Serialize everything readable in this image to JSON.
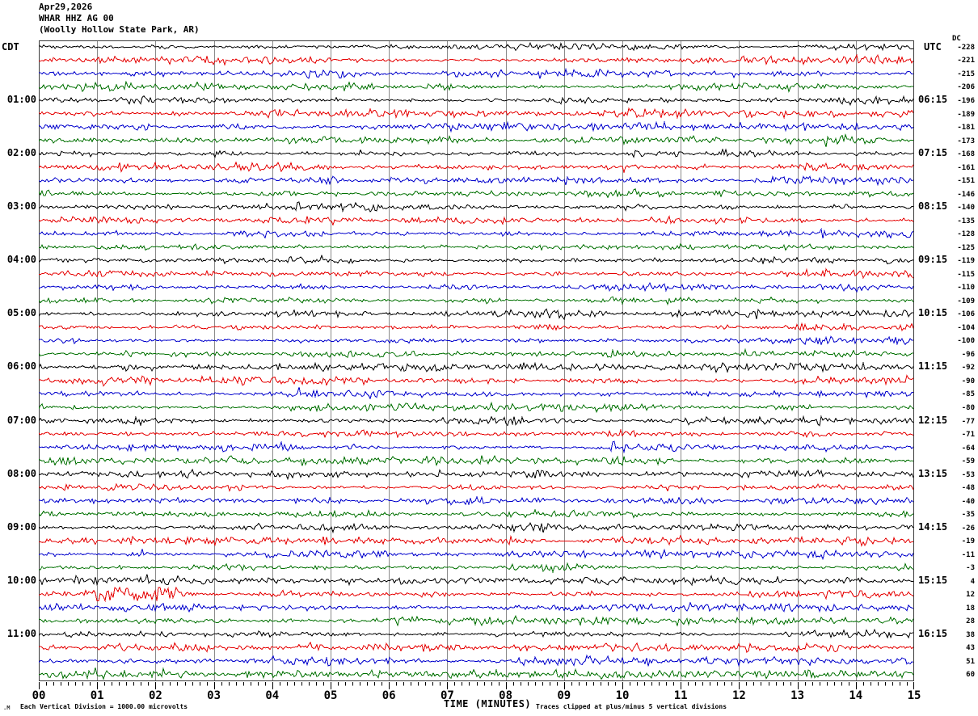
{
  "title": {
    "date": "Apr29,2026",
    "station": "WHAR HHZ AG 00",
    "location": "(Woolly Hollow State Park, AR)"
  },
  "axes": {
    "left_header": "CDT",
    "right_header": "UTC",
    "dc_header": "DC",
    "x_label": "TIME (MINUTES)",
    "x_ticks": [
      "00",
      "01",
      "02",
      "03",
      "04",
      "05",
      "06",
      "07",
      "08",
      "09",
      "10",
      "11",
      "12",
      "13",
      "14",
      "15"
    ]
  },
  "footer": {
    "scale_note": "Each Vertical Division = 1000.00 microvolts",
    "clip_note": "Traces clipped at plus/minus 5 vertical divisions",
    "corner_mark": ".M"
  },
  "colors": {
    "black": "#000000",
    "red": "#e60000",
    "blue": "#0000cc",
    "green": "#007000",
    "grid": "#8a8a8a",
    "border": "#3c3c3c"
  },
  "rows": [
    {
      "c": "black",
      "cdt": "",
      "utc": "",
      "dc": "-228"
    },
    {
      "c": "red",
      "cdt": "",
      "utc": "",
      "dc": "-221"
    },
    {
      "c": "blue",
      "cdt": "",
      "utc": "",
      "dc": "-215"
    },
    {
      "c": "green",
      "cdt": "",
      "utc": "",
      "dc": "-206"
    },
    {
      "c": "black",
      "cdt": "01:00",
      "utc": "06:15",
      "dc": "-196"
    },
    {
      "c": "red",
      "cdt": "",
      "utc": "",
      "dc": "-189"
    },
    {
      "c": "blue",
      "cdt": "",
      "utc": "",
      "dc": "-181"
    },
    {
      "c": "green",
      "cdt": "",
      "utc": "",
      "dc": "-173"
    },
    {
      "c": "black",
      "cdt": "02:00",
      "utc": "07:15",
      "dc": "-168"
    },
    {
      "c": "red",
      "cdt": "",
      "utc": "",
      "dc": "-161"
    },
    {
      "c": "blue",
      "cdt": "",
      "utc": "",
      "dc": "-151"
    },
    {
      "c": "green",
      "cdt": "",
      "utc": "",
      "dc": "-146"
    },
    {
      "c": "black",
      "cdt": "03:00",
      "utc": "08:15",
      "dc": "-140"
    },
    {
      "c": "red",
      "cdt": "",
      "utc": "",
      "dc": "-135"
    },
    {
      "c": "blue",
      "cdt": "",
      "utc": "",
      "dc": "-128"
    },
    {
      "c": "green",
      "cdt": "",
      "utc": "",
      "dc": "-125"
    },
    {
      "c": "black",
      "cdt": "04:00",
      "utc": "09:15",
      "dc": "-119"
    },
    {
      "c": "red",
      "cdt": "",
      "utc": "",
      "dc": "-115"
    },
    {
      "c": "blue",
      "cdt": "",
      "utc": "",
      "dc": "-110"
    },
    {
      "c": "green",
      "cdt": "",
      "utc": "",
      "dc": "-109"
    },
    {
      "c": "black",
      "cdt": "05:00",
      "utc": "10:15",
      "dc": "-106"
    },
    {
      "c": "red",
      "cdt": "",
      "utc": "",
      "dc": "-104"
    },
    {
      "c": "blue",
      "cdt": "",
      "utc": "",
      "dc": "-100"
    },
    {
      "c": "green",
      "cdt": "",
      "utc": "",
      "dc": "-96"
    },
    {
      "c": "black",
      "cdt": "06:00",
      "utc": "11:15",
      "dc": "-92"
    },
    {
      "c": "red",
      "cdt": "",
      "utc": "",
      "dc": "-90"
    },
    {
      "c": "blue",
      "cdt": "",
      "utc": "",
      "dc": "-85"
    },
    {
      "c": "green",
      "cdt": "",
      "utc": "",
      "dc": "-80"
    },
    {
      "c": "black",
      "cdt": "07:00",
      "utc": "12:15",
      "dc": "-77"
    },
    {
      "c": "red",
      "cdt": "",
      "utc": "",
      "dc": "-71"
    },
    {
      "c": "blue",
      "cdt": "",
      "utc": "",
      "dc": "-64"
    },
    {
      "c": "green",
      "cdt": "",
      "utc": "",
      "dc": "-59"
    },
    {
      "c": "black",
      "cdt": "08:00",
      "utc": "13:15",
      "dc": "-53"
    },
    {
      "c": "red",
      "cdt": "",
      "utc": "",
      "dc": "-48"
    },
    {
      "c": "blue",
      "cdt": "",
      "utc": "",
      "dc": "-40"
    },
    {
      "c": "green",
      "cdt": "",
      "utc": "",
      "dc": "-35"
    },
    {
      "c": "black",
      "cdt": "09:00",
      "utc": "14:15",
      "dc": "-26"
    },
    {
      "c": "red",
      "cdt": "",
      "utc": "",
      "dc": "-19"
    },
    {
      "c": "blue",
      "cdt": "",
      "utc": "",
      "dc": "-11"
    },
    {
      "c": "green",
      "cdt": "",
      "utc": "",
      "dc": "-3"
    },
    {
      "c": "black",
      "cdt": "10:00",
      "utc": "15:15",
      "dc": "4"
    },
    {
      "c": "red",
      "cdt": "",
      "utc": "",
      "dc": "12"
    },
    {
      "c": "blue",
      "cdt": "",
      "utc": "",
      "dc": "18"
    },
    {
      "c": "green",
      "cdt": "",
      "utc": "",
      "dc": "28"
    },
    {
      "c": "black",
      "cdt": "11:00",
      "utc": "16:15",
      "dc": "38"
    },
    {
      "c": "red",
      "cdt": "",
      "utc": "",
      "dc": "43"
    },
    {
      "c": "blue",
      "cdt": "",
      "utc": "",
      "dc": "51"
    },
    {
      "c": "green",
      "cdt": "",
      "utc": "",
      "dc": "60"
    }
  ],
  "chart_data": {
    "type": "line",
    "title": "WHAR HHZ AG 00 (Woolly Hollow State Park, AR) Apr29,2026 helicorder record",
    "xlabel": "TIME (MINUTES)",
    "x_range_minutes": [
      0,
      15
    ],
    "x_tick_labels": [
      "00",
      "01",
      "02",
      "03",
      "04",
      "05",
      "06",
      "07",
      "08",
      "09",
      "10",
      "11",
      "12",
      "13",
      "14",
      "15"
    ],
    "minor_ticks_per_minute": 8,
    "rows": 48,
    "minutes_per_row": 15,
    "row_color_cycle": [
      "black",
      "red",
      "blue",
      "green"
    ],
    "left_axis_header": "CDT",
    "left_axis_labels": [
      "01:00",
      "02:00",
      "03:00",
      "04:00",
      "05:00",
      "06:00",
      "07:00",
      "08:00",
      "09:00",
      "10:00",
      "11:00"
    ],
    "right_axis_header": "UTC",
    "right_axis_labels": [
      "06:15",
      "07:15",
      "08:15",
      "09:15",
      "10:15",
      "11:15",
      "12:15",
      "13:15",
      "14:15",
      "15:15",
      "16:15"
    ],
    "dc_offsets": [
      -228,
      -221,
      -215,
      -206,
      -196,
      -189,
      -181,
      -173,
      -168,
      -161,
      -151,
      -146,
      -140,
      -135,
      -128,
      -125,
      -119,
      -115,
      -110,
      -109,
      -106,
      -104,
      -100,
      -96,
      -92,
      -90,
      -85,
      -80,
      -77,
      -71,
      -64,
      -59,
      -53,
      -48,
      -40,
      -35,
      -26,
      -19,
      -11,
      -3,
      4,
      12,
      18,
      28,
      38,
      43,
      51,
      60
    ],
    "amplitude_scale": "Each Vertical Division = 1000.00 microvolts",
    "clipping": "Traces clipped at plus/minus 5 vertical divisions",
    "content_description": "continuous ambient seismic background noise on all 48 quarter-hour traces; no large events",
    "features": [
      {
        "row": 41,
        "row_label": "10:00 CDT red trace",
        "minutes": [
          0.9,
          2.4
        ],
        "gain": 2.4,
        "note": "slightly elevated amplitude burst"
      },
      {
        "row": 30,
        "row_label": "07:30 CDT blue trace",
        "minutes": [
          9.8,
          10.15
        ],
        "gain": 2.2,
        "note": "brief spike near minute 10"
      },
      {
        "row": 17,
        "row_label": "04:15 CDT red trace",
        "minutes": [
          13.1,
          13.5
        ],
        "gain": 1.7,
        "note": "small wiggle"
      }
    ],
    "grid": "vertical gray line each minute",
    "legend_position": "none"
  }
}
